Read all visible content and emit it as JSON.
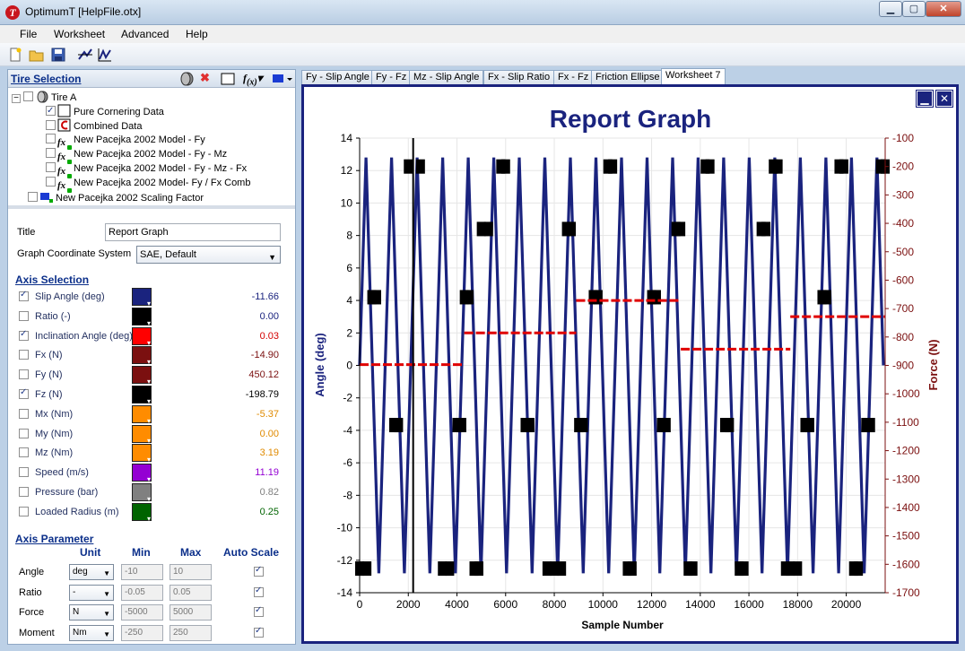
{
  "window": {
    "title": "OptimumT [HelpFile.otx]",
    "min_glyph": "▁",
    "max_glyph": "▢",
    "close_glyph": "✕"
  },
  "menu": [
    "File",
    "Worksheet",
    "Advanced",
    "Help"
  ],
  "toolbar": [
    "new-icon",
    "open-icon",
    "save-icon",
    "fit-icon",
    "graph-icon"
  ],
  "tire_selection": {
    "title": "Tire Selection",
    "tree": [
      {
        "label": "Tire A",
        "checked": false,
        "icon": "tire-icon",
        "level": 0
      },
      {
        "label": "Pure Cornering Data",
        "checked": true,
        "icon": "data-icon",
        "level": 1
      },
      {
        "label": "Combined Data",
        "checked": false,
        "icon": "combined-data-icon",
        "level": 1
      },
      {
        "label": "New Pacejka 2002 Model - Fy",
        "checked": false,
        "icon": "fx-model-icon",
        "level": 1
      },
      {
        "label": "New Pacejka 2002 Model - Fy - Mz",
        "checked": false,
        "icon": "fx-model-icon",
        "level": 1
      },
      {
        "label": "New Pacejka 2002 Model - Fy - Mz - Fx",
        "checked": false,
        "icon": "fx-model-icon",
        "level": 1
      },
      {
        "label": "New Pacejka 2002 Model- Fy / Fx Comb",
        "checked": false,
        "icon": "fx-model-icon",
        "level": 1
      },
      {
        "label": "New Pacejka 2002 Scaling Factor",
        "checked": false,
        "icon": "scaling-factor-icon",
        "level": 0
      }
    ]
  },
  "properties": {
    "title_label": "Title",
    "title_value": "Report Graph",
    "coord_label": "Graph Coordinate System",
    "coord_value": "SAE, Default",
    "axis_selection_label": "Axis Selection",
    "axes": [
      {
        "label": "Slip Angle (deg)",
        "checked": true,
        "color": "#1a237e",
        "value": "-11.66",
        "value_color": "#1a237e"
      },
      {
        "label": "Ratio (-)",
        "checked": false,
        "color": "#000000",
        "value": "0.00",
        "value_color": "#1a237e"
      },
      {
        "label": "Inclination Angle (deg)",
        "checked": true,
        "color": "#ff0000",
        "value": "0.03",
        "value_color": "#d40000"
      },
      {
        "label": "Fx (N)",
        "checked": false,
        "color": "#7b1010",
        "value": "-14.90",
        "value_color": "#7b1010"
      },
      {
        "label": "Fy (N)",
        "checked": false,
        "color": "#7b1010",
        "value": "450.12",
        "value_color": "#7b1010"
      },
      {
        "label": "Fz (N)",
        "checked": true,
        "color": "#000000",
        "value": "-198.79",
        "value_color": "#000000"
      },
      {
        "label": "Mx (Nm)",
        "checked": false,
        "color": "#ff8c00",
        "value": "-5.37",
        "value_color": "#e08a00"
      },
      {
        "label": "My (Nm)",
        "checked": false,
        "color": "#ff8c00",
        "value": "0.00",
        "value_color": "#e08a00"
      },
      {
        "label": "Mz (Nm)",
        "checked": false,
        "color": "#ff8c00",
        "value": "3.19",
        "value_color": "#e08a00"
      },
      {
        "label": "Speed (m/s)",
        "checked": false,
        "color": "#9400d3",
        "value": "11.19",
        "value_color": "#9400d3"
      },
      {
        "label": "Pressure (bar)",
        "checked": false,
        "color": "#808080",
        "value": "0.82",
        "value_color": "#808080"
      },
      {
        "label": "Loaded Radius (m)",
        "checked": false,
        "color": "#006400",
        "value": "0.25",
        "value_color": "#006400"
      }
    ],
    "axis_parameter_label": "Axis Parameter",
    "param_headers": {
      "unit": "Unit",
      "min": "Min",
      "max": "Max",
      "auto": "Auto Scale"
    },
    "params": [
      {
        "label": "Angle",
        "unit": "deg",
        "min": "-10",
        "max": "10",
        "auto": true
      },
      {
        "label": "Ratio",
        "unit": "-",
        "min": "-0.05",
        "max": "0.05",
        "auto": true
      },
      {
        "label": "Force",
        "unit": "N",
        "min": "-5000",
        "max": "5000",
        "auto": true
      },
      {
        "label": "Moment",
        "unit": "Nm",
        "min": "-250",
        "max": "250",
        "auto": true
      }
    ]
  },
  "tabs": [
    "Fy - Slip Angle",
    "Fy - Fz",
    "Mz - Slip Angle",
    "Fx - Slip Ratio",
    "Fx - Fz",
    "Friction Ellipse",
    "Worksheet 7"
  ],
  "active_tab": 6,
  "graph_window": {
    "restore_glyph": "▁",
    "close_glyph": "✕"
  },
  "chart_data": {
    "type": "line",
    "title": "Report Graph",
    "xlabel": "Sample Number",
    "ylabel_left": "Angle (deg)",
    "ylabel_right": "Force (N)",
    "xlim": [
      0,
      21600
    ],
    "ylim_left": [
      -14,
      14
    ],
    "ylim_right": [
      -1700,
      -100
    ],
    "x_ticks": [
      "0",
      "2000",
      "4000",
      "6000",
      "8000",
      "10000",
      "12000",
      "14000",
      "16000",
      "18000",
      "20000"
    ],
    "y_left_ticks": [
      "-14",
      "-12",
      "-10",
      "-8",
      "-6",
      "-4",
      "-2",
      "0",
      "2",
      "4",
      "6",
      "8",
      "10",
      "12",
      "14"
    ],
    "y_right_ticks": [
      "-1700",
      "-1600",
      "-1500",
      "-1400",
      "-1300",
      "-1200",
      "-1100",
      "-1000",
      "-900",
      "-800",
      "-700",
      "-600",
      "-500",
      "-400",
      "-300",
      "-200",
      "-100"
    ],
    "grid": true,
    "colors": {
      "slip": "#1a237e",
      "inclination": "#e00000",
      "fz": "#000000",
      "cursor": "#000000",
      "right_axis": "#7b1010",
      "title": "#1a237e"
    },
    "series": [
      {
        "name": "Slip Angle (deg)",
        "axis": "left",
        "pattern": "triangle",
        "amplitude": 12.8,
        "period_samples": 1050
      },
      {
        "name": "Inclination Angle (deg)",
        "axis": "left",
        "segments": [
          {
            "x0": 0,
            "x1": 4300,
            "y": 0.05
          },
          {
            "x0": 4300,
            "x1": 8900,
            "y": 2.0
          },
          {
            "x0": 8900,
            "x1": 13200,
            "y": 4.0
          },
          {
            "x0": 13200,
            "x1": 17700,
            "y": 1.0
          },
          {
            "x0": 17700,
            "x1": 21600,
            "y": 3.0
          }
        ]
      },
      {
        "name": "Fz (N)",
        "axis": "right",
        "points": [
          [
            0,
            -1615
          ],
          [
            300,
            -1615
          ],
          [
            500,
            -660
          ],
          [
            700,
            -660
          ],
          [
            1400,
            -1110
          ],
          [
            1600,
            -1110
          ],
          [
            2000,
            -200
          ],
          [
            2500,
            -200
          ],
          [
            3400,
            -1615
          ],
          [
            3700,
            -1615
          ],
          [
            4000,
            -1110
          ],
          [
            4200,
            -1110
          ],
          [
            4300,
            -660
          ],
          [
            4500,
            -660
          ],
          [
            4700,
            -1615
          ],
          [
            4900,
            -1615
          ],
          [
            5000,
            -420
          ],
          [
            5300,
            -420
          ],
          [
            5800,
            -200
          ],
          [
            6000,
            -200
          ],
          [
            6800,
            -1110
          ],
          [
            7000,
            -1110
          ],
          [
            7700,
            -1615
          ],
          [
            8000,
            -1615
          ],
          [
            8300,
            -1615
          ],
          [
            8500,
            -420
          ],
          [
            8700,
            -420
          ],
          [
            9000,
            -1110
          ],
          [
            9200,
            -1110
          ],
          [
            9600,
            -660
          ],
          [
            9800,
            -660
          ],
          [
            10200,
            -200
          ],
          [
            10400,
            -200
          ],
          [
            11000,
            -1615
          ],
          [
            11200,
            -1615
          ],
          [
            12000,
            -660
          ],
          [
            12200,
            -660
          ],
          [
            12400,
            -1110
          ],
          [
            12600,
            -1110
          ],
          [
            13000,
            -420
          ],
          [
            13200,
            -420
          ],
          [
            13500,
            -1615
          ],
          [
            13700,
            -1615
          ],
          [
            14200,
            -200
          ],
          [
            14400,
            -200
          ],
          [
            15000,
            -1110
          ],
          [
            15200,
            -1110
          ],
          [
            15600,
            -1615
          ],
          [
            15800,
            -1615
          ],
          [
            16500,
            -420
          ],
          [
            16700,
            -420
          ],
          [
            17000,
            -200
          ],
          [
            17200,
            -200
          ],
          [
            17500,
            -1615
          ],
          [
            17700,
            -1615
          ],
          [
            18000,
            -1615
          ],
          [
            18300,
            -1110
          ],
          [
            18500,
            -1110
          ],
          [
            19000,
            -660
          ],
          [
            19200,
            -660
          ],
          [
            19700,
            -200
          ],
          [
            19900,
            -200
          ],
          [
            20300,
            -1615
          ],
          [
            20500,
            -1615
          ],
          [
            20800,
            -1110
          ],
          [
            21000,
            -1110
          ],
          [
            21400,
            -200
          ],
          [
            21600,
            -200
          ]
        ]
      }
    ],
    "cursor_x": 2200
  }
}
